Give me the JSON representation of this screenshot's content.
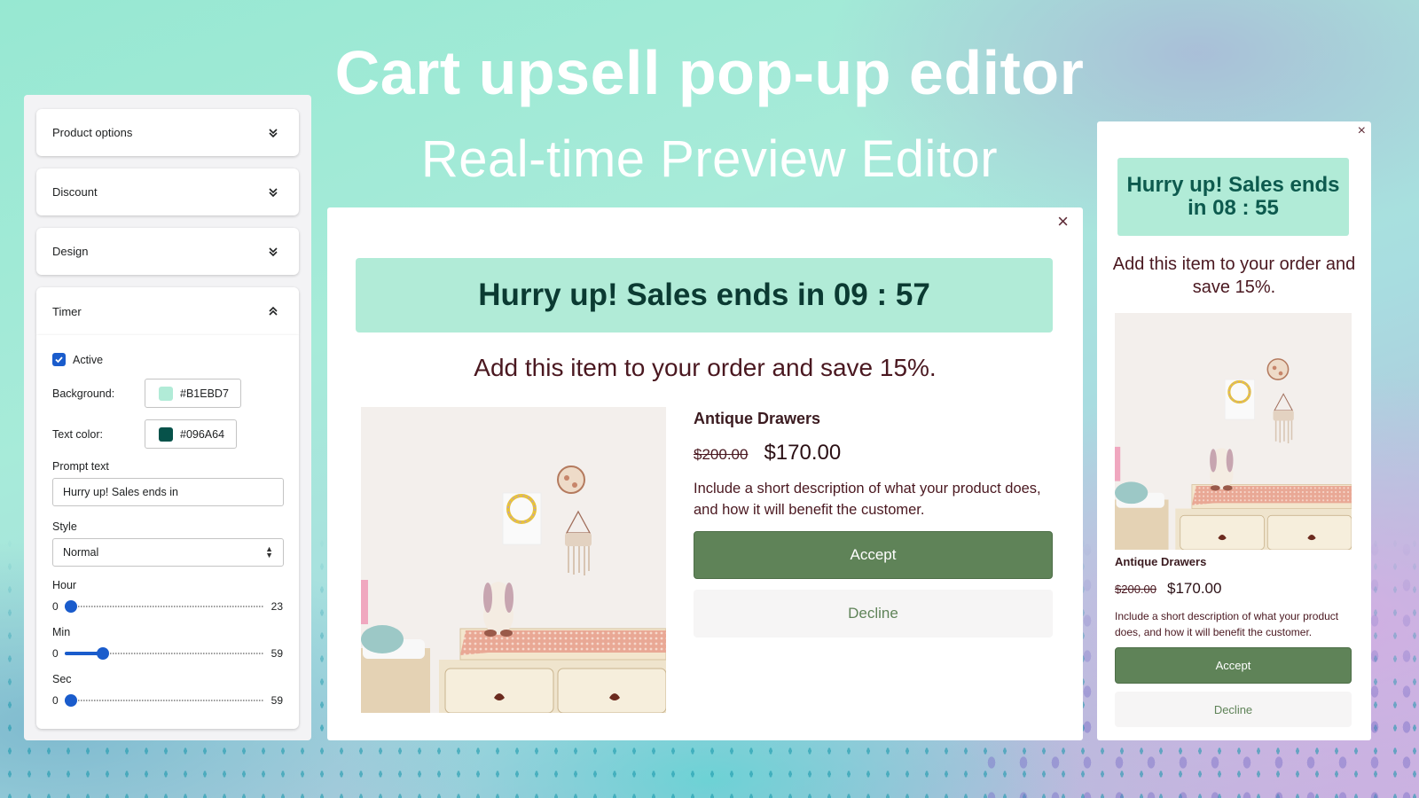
{
  "hero": {
    "title": "Cart upsell pop-up editor",
    "subtitle": "Real-time Preview Editor"
  },
  "editor": {
    "sections": [
      {
        "label": "Product options",
        "state": "collapsed"
      },
      {
        "label": "Discount",
        "state": "collapsed"
      },
      {
        "label": "Design",
        "state": "collapsed"
      },
      {
        "label": "Timer",
        "state": "expanded"
      }
    ],
    "timer": {
      "active_label": "Active",
      "active": true,
      "background_label": "Background:",
      "background_color": "#B1EBD7",
      "text_color_label": "Text color:",
      "text_color": "#096A64",
      "prompt_label": "Prompt text",
      "prompt_value": "Hurry up! Sales ends in",
      "style_label": "Style",
      "style_value": "Normal",
      "sliders": [
        {
          "label": "Hour",
          "min": "0",
          "max": "23",
          "value": 0
        },
        {
          "label": "Min",
          "min": "0",
          "max": "59",
          "value": 10
        },
        {
          "label": "Sec",
          "min": "0",
          "max": "59",
          "value": 0
        }
      ]
    }
  },
  "preview": {
    "close_icon": "×",
    "timer_text": "Hurry up! Sales ends in 09 : 57",
    "offer_text": "Add this item to your order and save 15%.",
    "product_name": "Antique Drawers",
    "old_price": "$200.00",
    "new_price": "$170.00",
    "description": "Include a short description of what your product does, and how it will benefit the customer.",
    "accept_label": "Accept",
    "decline_label": "Decline"
  },
  "mobile_preview": {
    "close_icon": "×",
    "timer_text": "Hurry up! Sales ends in 08 : 55",
    "offer_text": "Add this item to your order and save 15%.",
    "product_name": "Antique Drawers",
    "old_price": "$200.00",
    "new_price": "$170.00",
    "description": "Include a short description of what your product does, and how it will benefit the customer.",
    "accept_label": "Accept",
    "decline_label": "Decline"
  },
  "colors": {
    "timer_background": "#B1EBD7",
    "timer_text": "#096A64",
    "accept_button": "#5F8358",
    "accent_blue": "#1A5CCC"
  }
}
